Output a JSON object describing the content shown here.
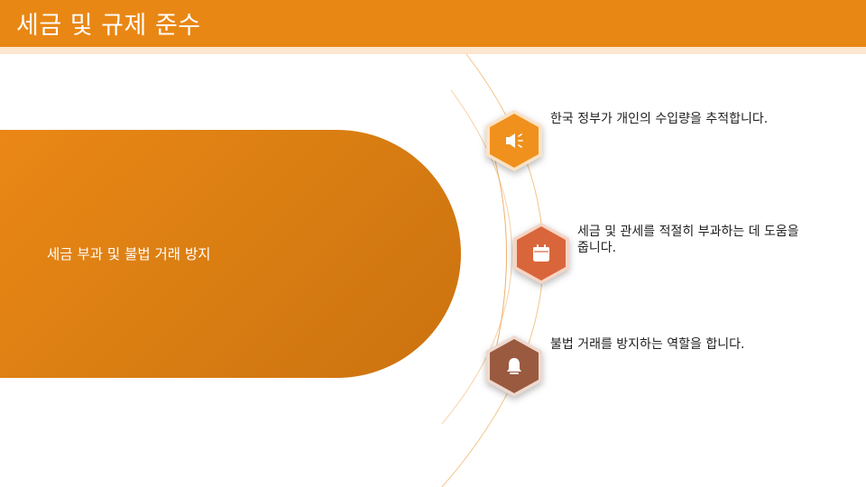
{
  "header": {
    "title": "세금 및 규제 준수"
  },
  "main": {
    "summary": "세금 부과 및 불법 거래 방지"
  },
  "items": [
    {
      "icon": "megaphone-icon",
      "text": "한국 정부가 개인의 수입량을 추적합니다."
    },
    {
      "icon": "calendar-icon",
      "text": "세금 및 관세를 적절히 부과하는 데 도움을 줍니다."
    },
    {
      "icon": "bell-icon",
      "text": "불법 거래를 방지하는 역할을 합니다."
    }
  ],
  "colors": {
    "accent": "#e98714",
    "accent_light": "#fce6cf",
    "hex_1": "#f0911d",
    "hex_2": "#d9663a",
    "hex_3": "#9a5a3f"
  }
}
